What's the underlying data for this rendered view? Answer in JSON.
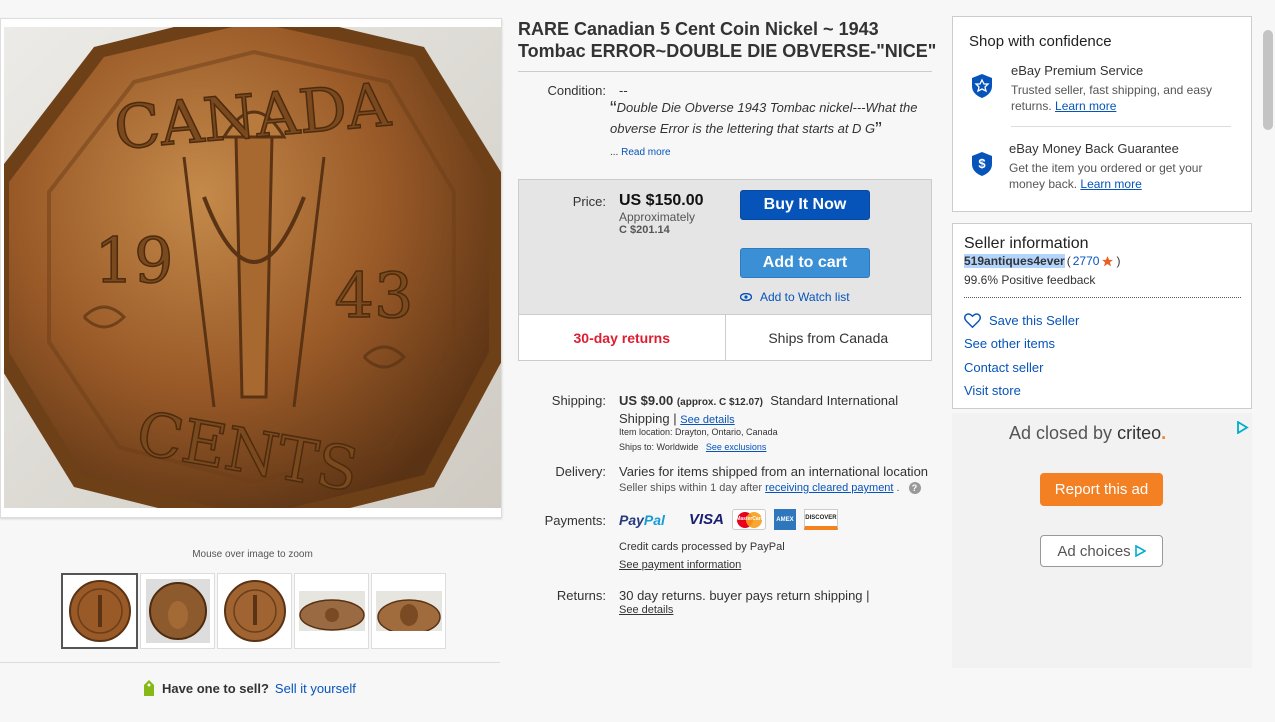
{
  "listing": {
    "title": "RARE Canadian 5 Cent Coin Nickel ~ 1943 Tombac ERROR~DOUBLE DIE OBVERSE-\"NICE\"",
    "condition_label": "Condition:",
    "condition_value": "--",
    "description": "Double Die Obverse 1943 Tombac nickel---What the obverse Error is the lettering that starts at D G",
    "ellipsis": "...",
    "read_more": "Read more"
  },
  "images": {
    "zoom_hint": "Mouse over image to zoom",
    "coin_text_top": "CANADA",
    "coin_text_bottom": "CENTS",
    "coin_year_left": "19",
    "coin_year_right": "43",
    "thumbnail_count": 5
  },
  "price": {
    "label": "Price:",
    "amount": "US $150.00",
    "approx": "Approximately",
    "converted": "C $201.14",
    "buy_now": "Buy It Now",
    "add_to_cart": "Add to cart",
    "watch": "Add to Watch list",
    "returns": "30-day returns",
    "ships_from": "Ships from Canada"
  },
  "shipping": {
    "label": "Shipping:",
    "cost": "US $9.00",
    "approx": "(approx. C $12.07)",
    "method": "Standard International Shipping",
    "sep": "|",
    "see_details": "See details",
    "location": "Item location:  Drayton, Ontario, Canada",
    "ships_to_label": "Ships to:  Worldwide",
    "see_exclusions": "See exclusions"
  },
  "delivery": {
    "label": "Delivery:",
    "text": "Varies for items shipped from an international location",
    "note_prefix": "Seller ships within 1 day after",
    "note_link": "receiving cleared payment",
    "note_suffix": ".",
    "help_icon": "?"
  },
  "payments": {
    "label": "Payments:",
    "paypal_a": "Pay",
    "paypal_b": "Pal",
    "visa": "VISA",
    "mastercard": "MasterCard",
    "amex": "AMEX",
    "discover": "DISCOVER",
    "credit_text": "Credit cards processed by PayPal",
    "see_info": "See payment information"
  },
  "returns": {
    "label": "Returns:",
    "text": "30 day returns. buyer pays return shipping |",
    "see_details": "See details"
  },
  "confidence": {
    "title": "Shop with confidence",
    "premium_title": "eBay Premium Service",
    "premium_text": "Trusted seller, fast shipping, and easy returns.",
    "premium_link": "Learn more",
    "mbg_title": "eBay Money Back Guarantee",
    "mbg_text": "Get the item you ordered or get your money back.",
    "mbg_link": "Learn more",
    "dollar": "$"
  },
  "seller": {
    "title": "Seller information",
    "name": "519antiques4ever",
    "open": "(",
    "score": "2770",
    "close": ")",
    "feedback": "99.6% Positive feedback",
    "save": "Save this Seller",
    "other_items": "See other items",
    "contact": "Contact seller",
    "store": "Visit store"
  },
  "ad": {
    "closed_prefix": "Ad closed by",
    "brand": "criteo",
    "brand_dot": ".",
    "report": "Report this ad",
    "choices": "Ad choices"
  },
  "sell": {
    "question": "Have one to sell?",
    "link": "Sell it yourself"
  },
  "colors": {
    "link": "#0654ba",
    "buy_button": "#0654ba",
    "cart_button": "#3b8fd5",
    "returns_red": "#dd1e31",
    "report_orange": "#f48024",
    "seller_highlight": "#b3d4fc"
  }
}
